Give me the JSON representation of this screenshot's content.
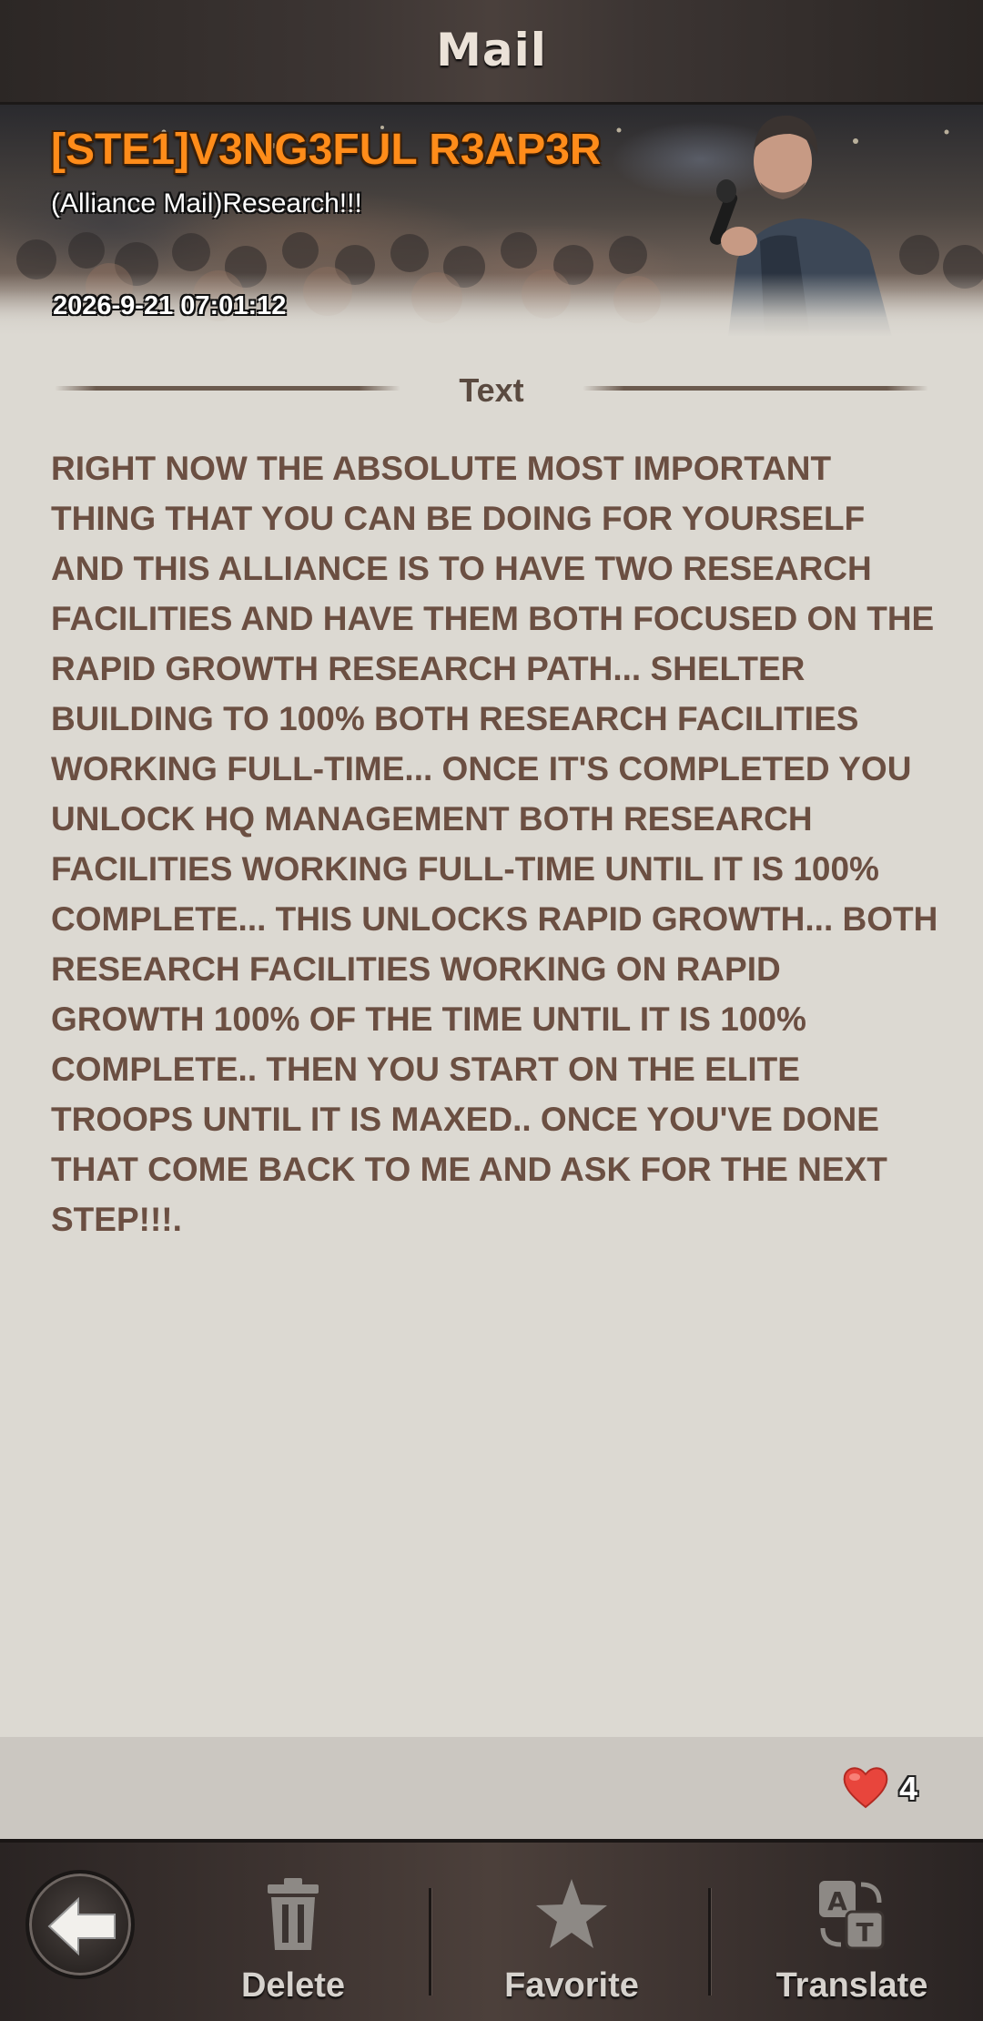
{
  "header": {
    "title": "Mail"
  },
  "mail": {
    "sender": "[STE1]V3NG3FUL R3AP3R",
    "subject": "(Alliance Mail)Research!!!",
    "timestamp": "2026-9-21 07:01:12",
    "section_label": "Text",
    "body": "RIGHT NOW THE ABSOLUTE MOST IMPORTANT THING THAT YOU CAN BE DOING FOR YOURSELF AND THIS ALLIANCE IS TO HAVE TWO RESEARCH FACILITIES AND HAVE THEM BOTH FOCUSED ON THE RAPID GROWTH RESEARCH PATH... SHELTER BUILDING TO 100% BOTH RESEARCH FACILITIES WORKING FULL-TIME... ONCE IT'S COMPLETED YOU UNLOCK HQ MANAGEMENT BOTH RESEARCH FACILITIES WORKING FULL-TIME UNTIL IT IS 100% COMPLETE... THIS UNLOCKS RAPID GROWTH... BOTH RESEARCH FACILITIES WORKING ON RAPID GROWTH 100% OF THE TIME UNTIL IT IS 100% COMPLETE.. THEN YOU START ON THE ELITE TROOPS UNTIL IT IS MAXED.. ONCE YOU'VE DONE THAT COME BACK TO ME AND ASK FOR THE NEXT STEP!!!."
  },
  "likes": {
    "count": "4",
    "icon": "heart-icon",
    "color": "#e8453c"
  },
  "toolbar": {
    "back_icon": "back-arrow-icon",
    "delete_label": "Delete",
    "delete_icon": "trash-icon",
    "favorite_label": "Favorite",
    "favorite_icon": "star-icon",
    "translate_label": "Translate",
    "translate_icon": "translate-icon"
  },
  "colors": {
    "sender": "#ff8c1a",
    "body_text": "#6b4f42",
    "background": "#dcd9d2"
  }
}
